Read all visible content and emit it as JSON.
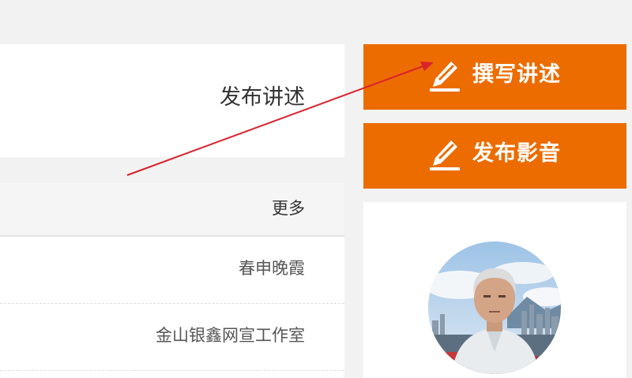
{
  "publish_panel": {
    "title": "发布讲述"
  },
  "list_panel": {
    "more_label": "更多",
    "rows": [
      {
        "author": "春申晚霞"
      },
      {
        "author": "金山银鑫网宣工作室"
      }
    ]
  },
  "actions": {
    "write_label": "撰写讲述",
    "media_label": "发布影音",
    "write_icon": "pencil-write-icon",
    "media_icon": "pencil-write-icon"
  },
  "colors": {
    "accent": "#ec6c00",
    "background": "#f2f2f2",
    "arrow": "#d9232d"
  }
}
